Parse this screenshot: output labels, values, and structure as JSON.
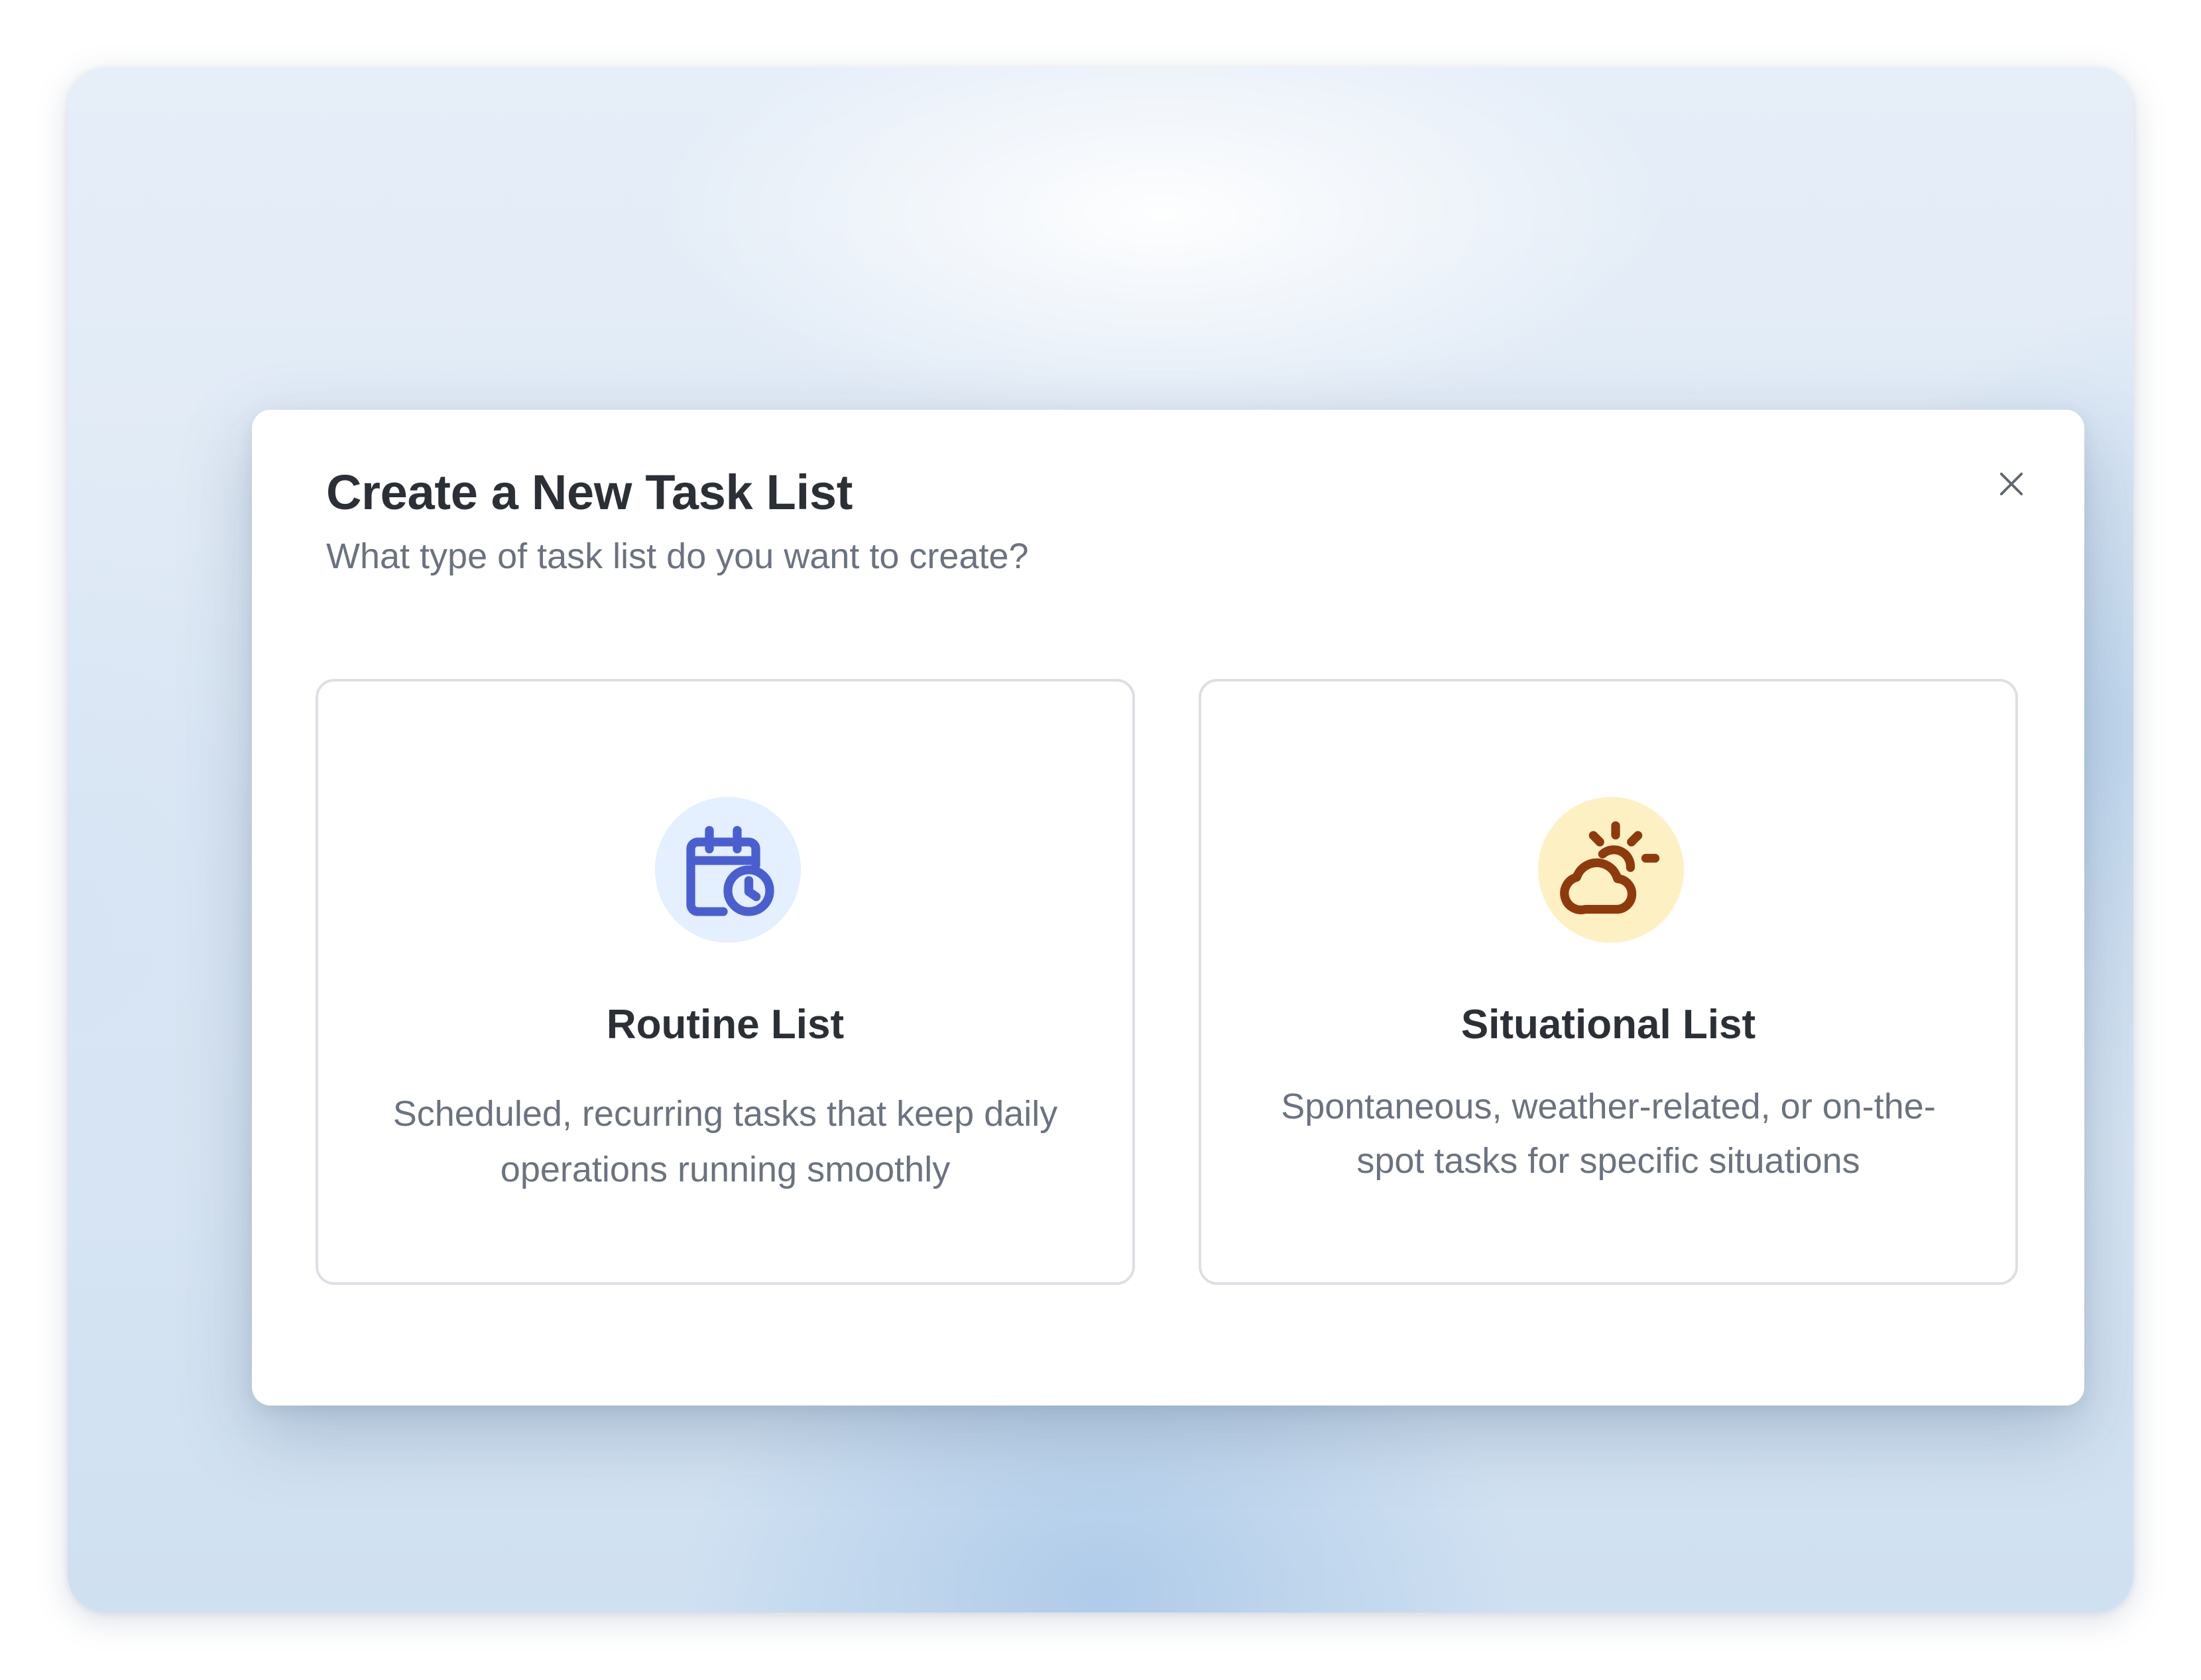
{
  "dialog": {
    "title": "Create a New Task List",
    "subtitle": "What type of task list do you want to create?",
    "close_icon": "close-icon"
  },
  "options": [
    {
      "title": "Routine List",
      "description": "Scheduled, recurring tasks that keep daily operations running smoothly",
      "icon": "calendar-clock-icon",
      "icon_color": "#4a5fcf",
      "icon_bg": "#e4efff"
    },
    {
      "title": "Situational List",
      "description": "Spontaneous, weather-related, or on-the-spot tasks for specific situations",
      "icon": "sun-behind-cloud-icon",
      "icon_color": "#8f3a0c",
      "icon_bg": "#fdf1c4"
    }
  ],
  "colors": {
    "title_text": "#2b2f36",
    "secondary_text": "#6b7280",
    "card_border": "#dcdfe4"
  }
}
